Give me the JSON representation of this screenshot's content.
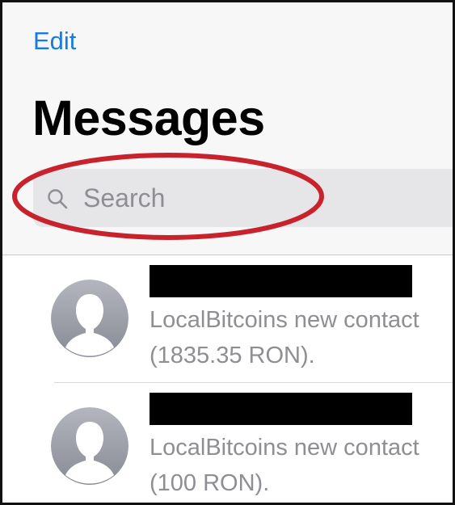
{
  "nav": {
    "edit_label": "Edit"
  },
  "header": {
    "title": "Messages"
  },
  "search": {
    "placeholder": "Search"
  },
  "messages": [
    {
      "sender": "[redacted]",
      "preview_line1": "LocalBitcoins new contact",
      "preview_line2": "(1835.35 RON)."
    },
    {
      "sender": "[redacted]",
      "preview_line1": "LocalBitcoins new contact",
      "preview_line2": "(100 RON)."
    }
  ],
  "colors": {
    "accent": "#1a7ae0",
    "annotation": "#c8232c",
    "secondary_text": "#8e8e93",
    "search_bg": "#e6e6e9",
    "header_bg": "#f7f7f7"
  },
  "icons": [
    "search-icon",
    "contact-avatar-icon"
  ]
}
